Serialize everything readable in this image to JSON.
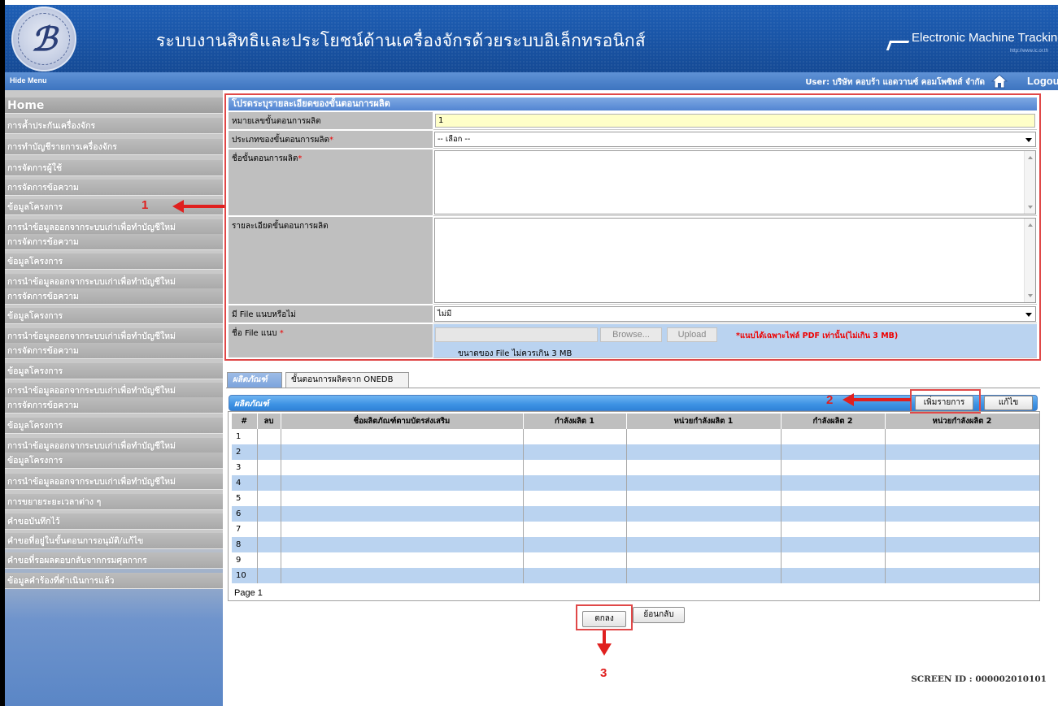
{
  "header": {
    "site_title": "ระบบงานสิทธิและประโยชน์ด้านเครื่องจักรด้วยระบบอิเล็กทรอนิกส์",
    "brand": "Electronic Machine Tracking",
    "brand_url": "http://www.ic.or.th",
    "logo_icon": "investor-club-association-logo"
  },
  "topbar": {
    "hide_menu": "Hide Menu",
    "user": "User: บริษัท คอบร้า แอดวานซ์ คอมโพซิทส์ จำกัด",
    "logout": "Logout",
    "home_icon": "home-icon"
  },
  "sidebar": {
    "home": "Home",
    "items": [
      "การค้ำประกันเครื่องจักร",
      "การทำบัญชีรายการเครื่องจักร",
      "การจัดการผู้ใช้",
      "การจัดการข้อความ",
      "ข้อมูลโครงการ",
      "การนำข้อมูลออกจากระบบเก่าเพื่อทำบัญชีใหม่",
      "การจัดการข้อความ",
      "ข้อมูลโครงการ",
      "การนำข้อมูลออกจากระบบเก่าเพื่อทำบัญชีใหม่",
      "การจัดการข้อความ",
      "ข้อมูลโครงการ",
      "การนำข้อมูลออกจากระบบเก่าเพื่อทำบัญชีใหม่",
      "การจัดการข้อความ",
      "ข้อมูลโครงการ",
      "การนำข้อมูลออกจากระบบเก่าเพื่อทำบัญชีใหม่",
      "การจัดการข้อความ",
      "ข้อมูลโครงการ",
      "การนำข้อมูลออกจากระบบเก่าเพื่อทำบัญชีใหม่",
      "ข้อมูลโครงการ",
      "การนำข้อมูลออกจากระบบเก่าเพื่อทำบัญชีใหม่",
      "การขยายระยะเวลาต่าง ๆ",
      "คำขอบันทึกไว้",
      "คำขอที่อยู่ในขั้นตอนการอนุมัติ/แก้ไข",
      "คำขอที่รอผลตอบกลับจากกรมศุลกากร",
      "ข้อมูลคำร้องที่ดำเนินการแล้ว"
    ]
  },
  "form": {
    "title": "โปรดระบุรายละเอียดของขั้นตอนการผลิต",
    "step_no_label": "หมายเลขขั้นตอนการผลิต",
    "step_no_value": "1",
    "step_type_label": "ประเภทของขั้นตอนการผลิต",
    "step_type_value": "-- เลือก --",
    "step_name_label": "ชื่อขั้นตอนการผลิต",
    "step_detail_label": "รายละเอียดขั้นตอนการผลิต",
    "has_file_label": "มี File แนบหรือไม่",
    "has_file_value": "ไม่มี",
    "file_name_label": "ชื่อ File แนบ",
    "required_mark": "*",
    "browse": "Browse...",
    "upload": "Upload",
    "file_note": "*แนบได้เฉพาะไฟล์ PDF เท่านั้น(ไม่เกิน 3 MB)",
    "file_size_note": "ขนาดของ File ไม่ควรเกิน 3 MB"
  },
  "tabs": [
    {
      "label": "ผลิตภัณฑ์",
      "active": true
    },
    {
      "label": "ขั้นตอนการผลิตจาก ONEDB",
      "active": false
    }
  ],
  "products": {
    "bar_label": "ผลิตภัณฑ์",
    "add_button": "เพิ่มรายการ",
    "edit_button": "แก้ไข",
    "columns": [
      "#",
      "ลบ",
      "ชื่อผลิตภัณฑ์ตามบัตรส่งเสริม",
      "กำลังผลิต 1",
      "หน่วยกำลังผลิต 1",
      "กำลังผลิต 2",
      "หน่วยกำลังผลิต 2"
    ],
    "rows": [
      "1",
      "2",
      "3",
      "4",
      "5",
      "6",
      "7",
      "8",
      "9",
      "10"
    ],
    "page_label": "Page 1"
  },
  "actions": {
    "ok_button": "ตกลง",
    "back_button": "ย้อนกลับ"
  },
  "callouts": [
    "1",
    "2",
    "3"
  ],
  "screen_id": "SCREEN ID :  000002010101",
  "colors": {
    "header_blue": "#1a56a8",
    "annotation_red": "#e0201f",
    "sidebar_gray": "#bdbdbd",
    "row_blue": "#bad3f0",
    "input_yellow": "#ffffc8"
  }
}
